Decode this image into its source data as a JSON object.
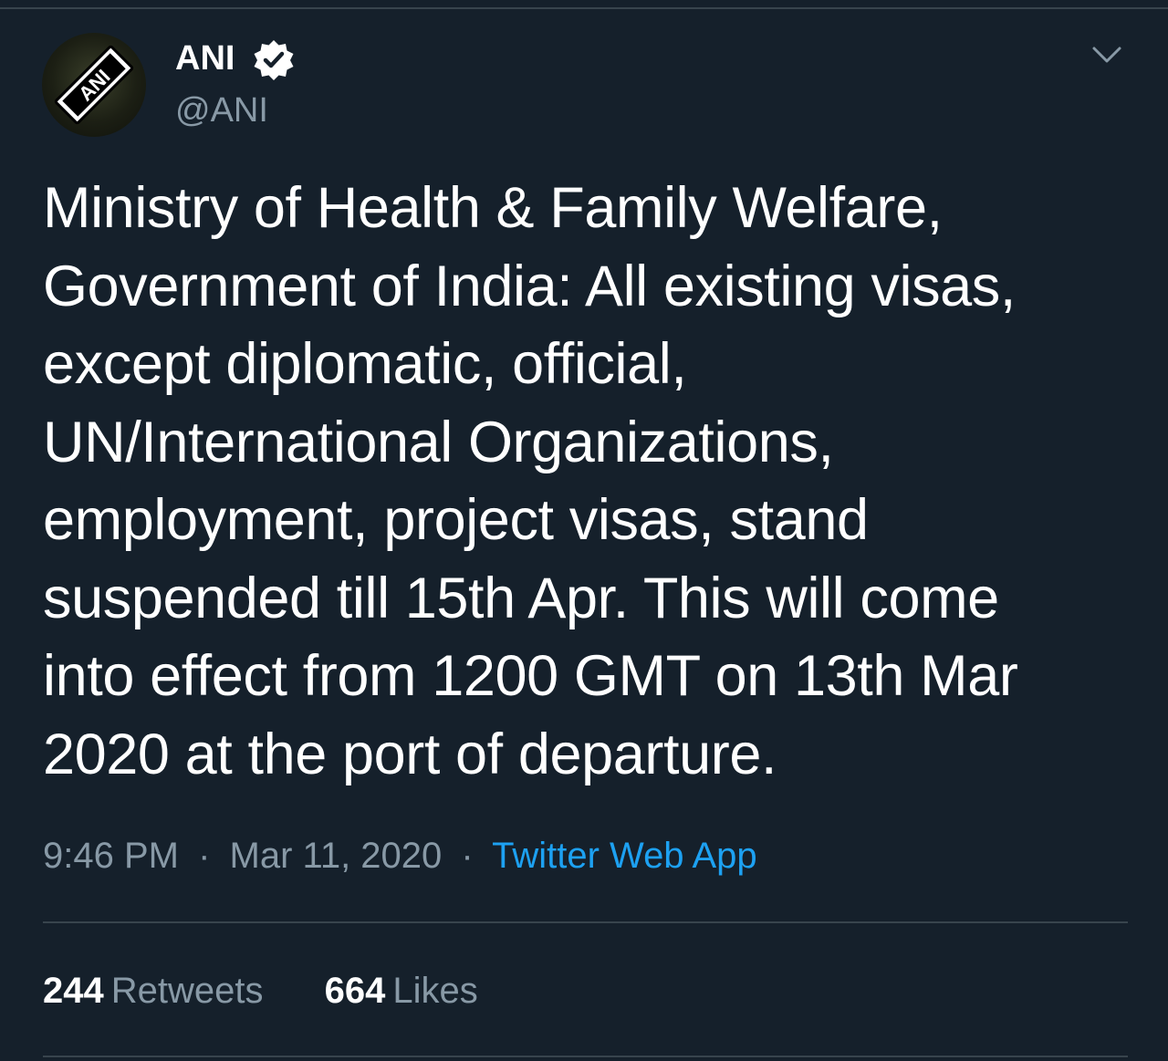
{
  "tweet": {
    "author": {
      "display_name": "ANI",
      "handle": "@ANI",
      "verified": true,
      "avatar_text": "ANI"
    },
    "text_lines": [
      "Ministry of Health & Family Welfare,",
      "Government of India: All existing visas,",
      "except diplomatic, official,",
      "UN/International Organizations,",
      "employment, project visas, stand",
      "suspended till 15th Apr. This will come",
      "into effect from 1200 GMT on 13th Mar",
      "2020 at the port of departure."
    ],
    "time": "9:46 PM",
    "separator": "·",
    "date": "Mar 11, 2020",
    "source": "Twitter Web App",
    "stats": {
      "retweets_count": "244",
      "retweets_label": "Retweets",
      "likes_count": "664",
      "likes_label": "Likes"
    }
  },
  "icons": {
    "verified": "verified-badge-icon",
    "menu": "chevron-down-icon"
  },
  "colors": {
    "background": "#15202b",
    "primary_text": "#ffffff",
    "secondary_text": "#8899a6",
    "link": "#1da1f2",
    "divider": "#38444d"
  }
}
